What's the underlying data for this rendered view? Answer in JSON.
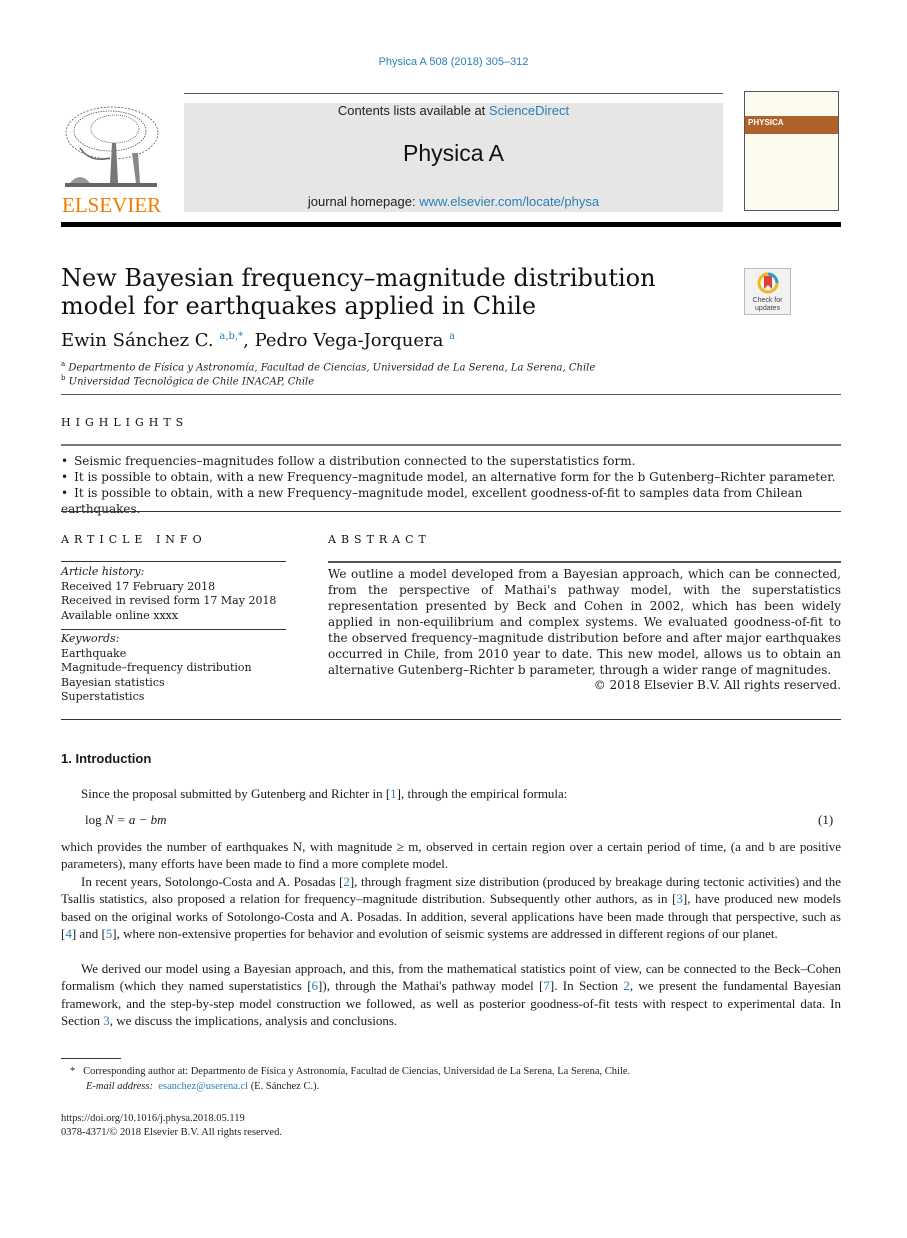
{
  "running_head": "Physica A 508 (2018) 305–312",
  "masthead": {
    "publisher_wordmark": "ELSEVIER",
    "contents_prefix": "Contents lists available at ",
    "contents_link": "ScienceDirect",
    "journal_title": "Physica A",
    "homepage_prefix": "journal homepage: ",
    "homepage_link": "www.elsevier.com/locate/physa",
    "cover_label": "PHYSICA",
    "accent_color": "#f07d00",
    "link_color": "#2a7fb5"
  },
  "crossmark": {
    "label": "Check for updates"
  },
  "article": {
    "title": "New Bayesian frequency–magnitude distribution model for earthquakes applied in Chile",
    "authors": [
      {
        "name": "Ewin Sánchez C.",
        "affil_marks": "a,b,*"
      },
      {
        "name": "Pedro Vega-Jorquera",
        "affil_marks": "a"
      }
    ],
    "author_separator": ", ",
    "affiliations": [
      {
        "mark": "a",
        "text": "Departmento de Física y Astronomía, Facultad de Ciencias, Universidad de La Serena, La Serena,  Chile"
      },
      {
        "mark": "b",
        "text": "Universidad Tecnológica de Chile INACAP,  Chile"
      }
    ]
  },
  "highlights": {
    "heading": "HIGHLIGHTS",
    "items": [
      "Seismic frequencies–magnitudes follow a distribution connected to the superstatistics form.",
      "It is possible to obtain, with a new Frequency–magnitude model, an alternative form for the b Gutenberg–Richter parameter.",
      "It is possible to obtain, with a new Frequency–magnitude model, excellent goodness-of-fit to samples data from Chilean earthquakes."
    ]
  },
  "article_info": {
    "heading": "ARTICLE INFO",
    "history_label": "Article history:",
    "history": [
      "Received 17 February 2018",
      "Received in revised form 17 May 2018",
      "Available online xxxx"
    ],
    "keywords_label": "Keywords:",
    "keywords": [
      "Earthquake",
      "Magnitude–frequency distribution",
      "Bayesian statistics",
      "Superstatistics"
    ]
  },
  "abstract": {
    "heading": "ABSTRACT",
    "text": "We outline a model developed from a Bayesian approach, which can be connected, from the perspective of Mathai's pathway model, with the superstatistics representation presented by Beck and Cohen in 2002, which has been widely applied in non-equilibrium and complex systems. We evaluated goodness-of-fit to the observed frequency–magnitude distribution before and after major earthquakes occurred in Chile, from 2010 year to date. This new model, allows us to obtain an alternative Gutenberg–Richter b parameter, through a wider range of magnitudes.",
    "copyright": "© 2018 Elsevier B.V. All rights reserved."
  },
  "body": {
    "section_heading": "1.  Introduction",
    "para1": {
      "before": "Since the proposal submitted by Gutenberg and Richter in [",
      "ref": "1",
      "after": "], through the empirical formula:"
    },
    "equation": {
      "lhs_fn": "log",
      "lhs_var": "N",
      "rhs": " = a − bm",
      "number": "(1)"
    },
    "para2": "which provides the number of earthquakes N, with magnitude ≥  m, observed in certain region over a certain period of time, (a and b are positive parameters), many efforts have been made to find a more complete model.",
    "para3": {
      "s1": "In recent years, Sotolongo-Costa and A. Posadas [",
      "r1": "2",
      "s2": "], through fragment size distribution (produced by breakage during tectonic activities) and the Tsallis statistics, also proposed a relation for frequency–magnitude distribution. Subsequently other authors, as in [",
      "r2": "3",
      "s3": "], have produced new models based on the original works of Sotolongo-Costa and A. Posadas. In addition, several applications have been made through that perspective, such as [",
      "r3": "4",
      "s4": "] and [",
      "r4": "5",
      "s5": "], where non-extensive properties for behavior and evolution of seismic systems are addressed in different regions of our planet."
    },
    "para4": {
      "s1": "We derived our model using a Bayesian approach, and this, from the mathematical statistics point of view, can be connected to the Beck–Cohen formalism (which they named superstatistics [",
      "r1": "6",
      "s2": "]), through the Mathai's pathway model [",
      "r2": "7",
      "s3": "]. In Section ",
      "r3": "2",
      "s4": ", we present the fundamental Bayesian framework, and the step-by-step model construction we followed, as well as posterior goodness-of-fit tests with respect to experimental data. In Section ",
      "r4": "3",
      "s5": ", we discuss the implications, analysis and conclusions."
    }
  },
  "footnotes": {
    "star": "*",
    "corresponding": "Corresponding author at: Departmento de Física y Astronomía, Facultad de Ciencias, Universidad de La Serena, La Serena,  Chile.",
    "email_label": "E-mail address:",
    "email": "esanchez@userena.cl",
    "email_owner": " (E. Sánchez C.).",
    "doi": "https://doi.org/10.1016/j.physa.2018.05.119",
    "issn": "0378-4371/© 2018 Elsevier B.V. All rights reserved."
  }
}
